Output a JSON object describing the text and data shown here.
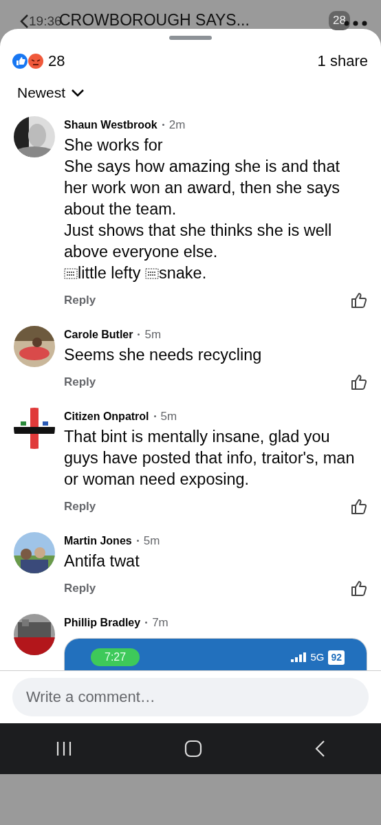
{
  "status_bar": {
    "time": "19:36",
    "battery": "28"
  },
  "header": {
    "title": "CROWBOROUGH SAYS..."
  },
  "reactions": {
    "count": "28",
    "shares": "1 share"
  },
  "sort": {
    "label": "Newest"
  },
  "comments": [
    {
      "author": "Shaun Westbrook",
      "time": "2m",
      "parts": [
        {
          "kind": "text",
          "text": "She works for\nShe says how amazing she is and that her work won an award, then she says about the team.\nJust shows that she thinks she is well above everyone else.\n"
        },
        {
          "kind": "object"
        },
        {
          "kind": "text",
          "text": "little lefty "
        },
        {
          "kind": "object"
        },
        {
          "kind": "text",
          "text": "snake."
        }
      ],
      "reply": "Reply"
    },
    {
      "author": "Carole Butler",
      "time": "5m",
      "text": "Seems she needs recycling",
      "reply": "Reply"
    },
    {
      "author": "Citizen Onpatrol",
      "time": "5m",
      "text": "That bint is mentally insane, glad you guys have posted that info, traitor's, man or woman need exposing.",
      "reply": "Reply"
    },
    {
      "author": "Martin Jones",
      "time": "5m",
      "text": "Antifa twat",
      "reply": "Reply"
    },
    {
      "author": "Phillip Bradley",
      "time": "7m",
      "attachment": {
        "time": "7:27",
        "network": "5G",
        "battery": "92"
      }
    }
  ],
  "composer": {
    "placeholder": "Write a comment…"
  }
}
